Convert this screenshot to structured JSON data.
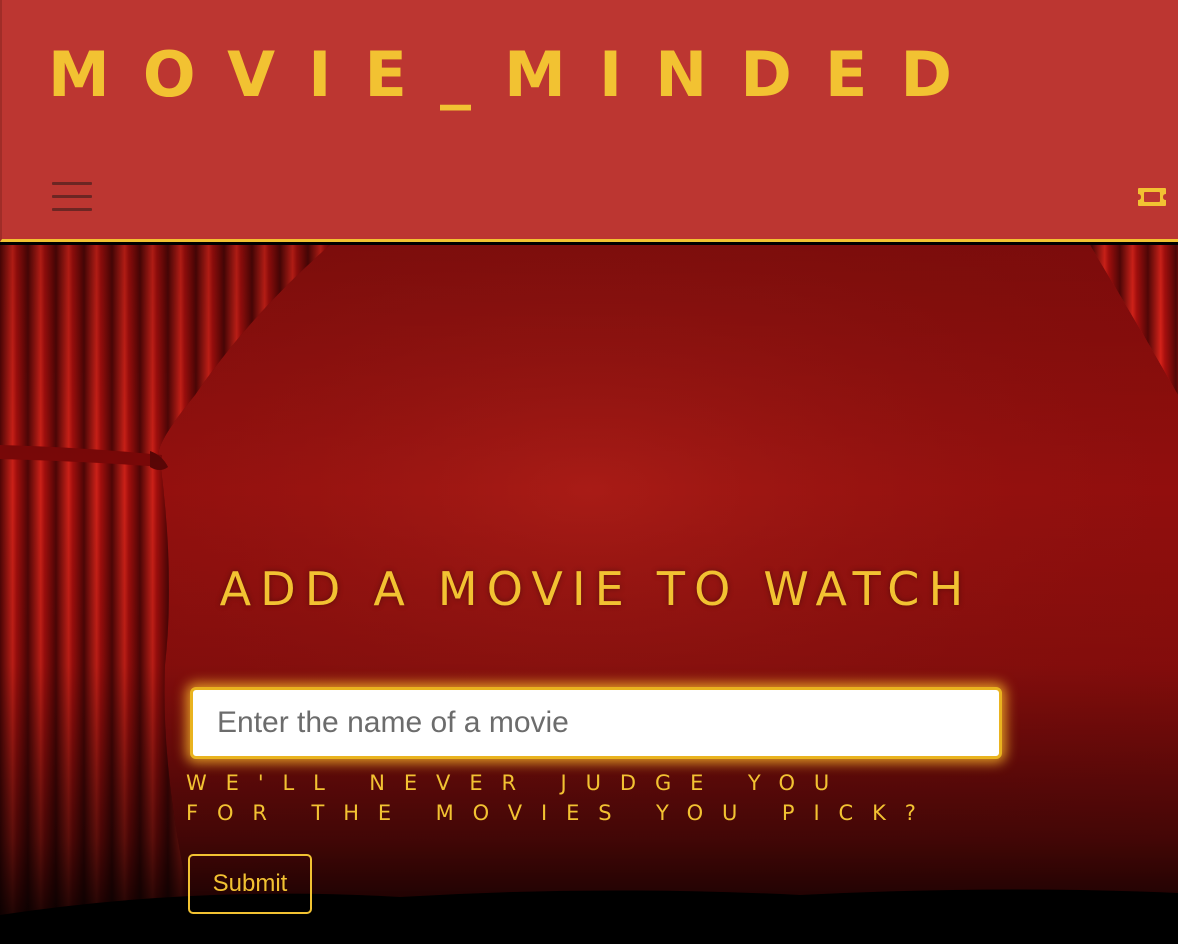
{
  "header": {
    "brand": "MOVIE_MINDED",
    "menu_icon": "hamburger-menu-icon",
    "ticket_icon": "ticket-icon"
  },
  "form": {
    "title": "ADD A MOVIE TO WATCH",
    "input_placeholder": "Enter the name of a movie",
    "input_value": "",
    "help_text": "WE'LL NEVER JUDGE YOU FOR THE MOVIES YOU PICK?",
    "submit_label": "Submit"
  },
  "colors": {
    "header_bg": "#bc3631",
    "accent_gold": "#f2c232",
    "curtain_red": "#b3100f"
  }
}
